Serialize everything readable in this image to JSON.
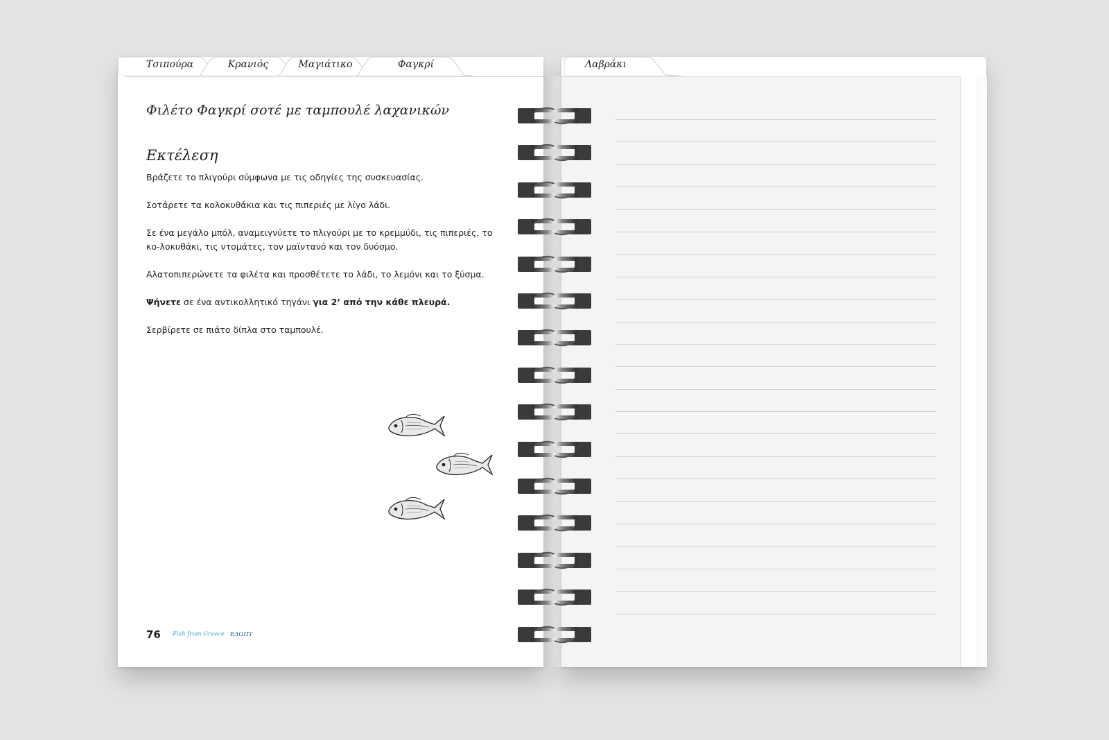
{
  "left_page": {
    "tabs": [
      "Τσιπούρα",
      "Κρανιός",
      "Μαγιάτικο",
      "Φαγκρί"
    ],
    "recipe_title": "Φιλέτο Φαγκρί σοτέ με ταμπουλέ λαχανικών",
    "section_title": "Εκτέλεση",
    "steps": {
      "s1": "Βράζετε το πλιγούρι σύμφωνα με τις οδηγίες της συσκευασίας.",
      "s2": "Σοτάρετε τα κολοκυθάκια και τις πιπεριές με λίγο λάδι.",
      "s3": "Σε ένα μεγάλο μπόλ, αναμειγνύετε το πλιγούρι με το κρεμμύδι, τις πιπεριές, το κο-λοκυθάκι, τις ντομάτες, τον μαϊντανό και τον δυόσμο.",
      "s4": "Αλατοπιπερώνετε τα φιλέτα και προσθέτετε το λάδι, το λεμόνι και το ξύσμα.",
      "s5_bold1": "Ψήνετε",
      "s5_mid": " σε ένα αντικολλητικό τηγάνι ",
      "s5_bold2": "για 2’ από την κάθε πλευρά.",
      "s6": "Σερβίρετε σε πιάτο δίπλα στο ταμπουλέ."
    },
    "page_number": "76",
    "brand": "Fish from Greece",
    "brand2": "ΕΛΟΠΥ"
  },
  "right_page": {
    "tab": "Λαβράκι"
  },
  "colors": {
    "background": "#e3e3e3",
    "brand_blue": "#3aa0d0",
    "brand_dark_blue": "#1b5e9e"
  }
}
